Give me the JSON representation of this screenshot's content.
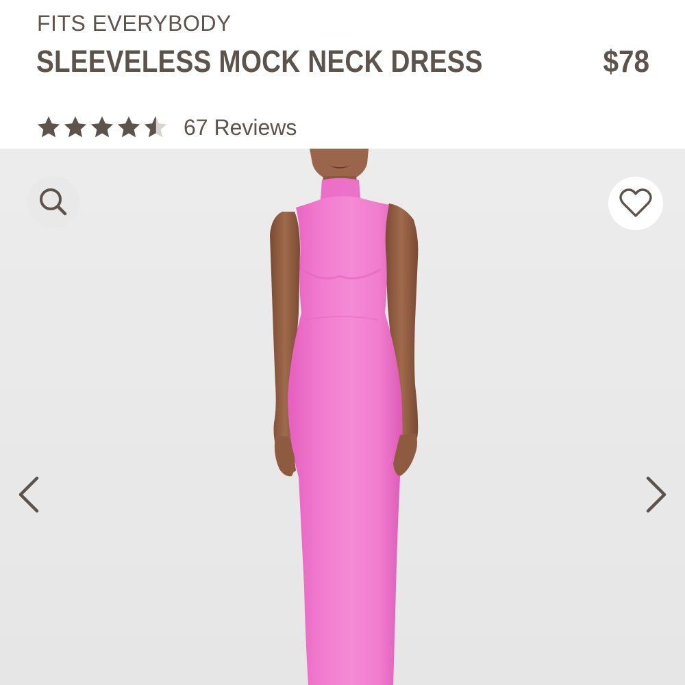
{
  "product": {
    "collection": "FITS EVERYBODY",
    "title": "SLEEVELESS MOCK NECK DRESS",
    "price": "$78",
    "rating": 4.5,
    "rating_max": 5,
    "reviews_text": "67 Reviews"
  },
  "icons": {
    "zoom": "search-icon",
    "wishlist": "heart-outline-icon",
    "prev": "chevron-left-icon",
    "next": "chevron-right-icon",
    "star": "star-icon"
  },
  "colors": {
    "text": "#5c534c",
    "star": "#5c534c",
    "dress": "#f27ccf",
    "image_background": "#e9e9e9"
  }
}
